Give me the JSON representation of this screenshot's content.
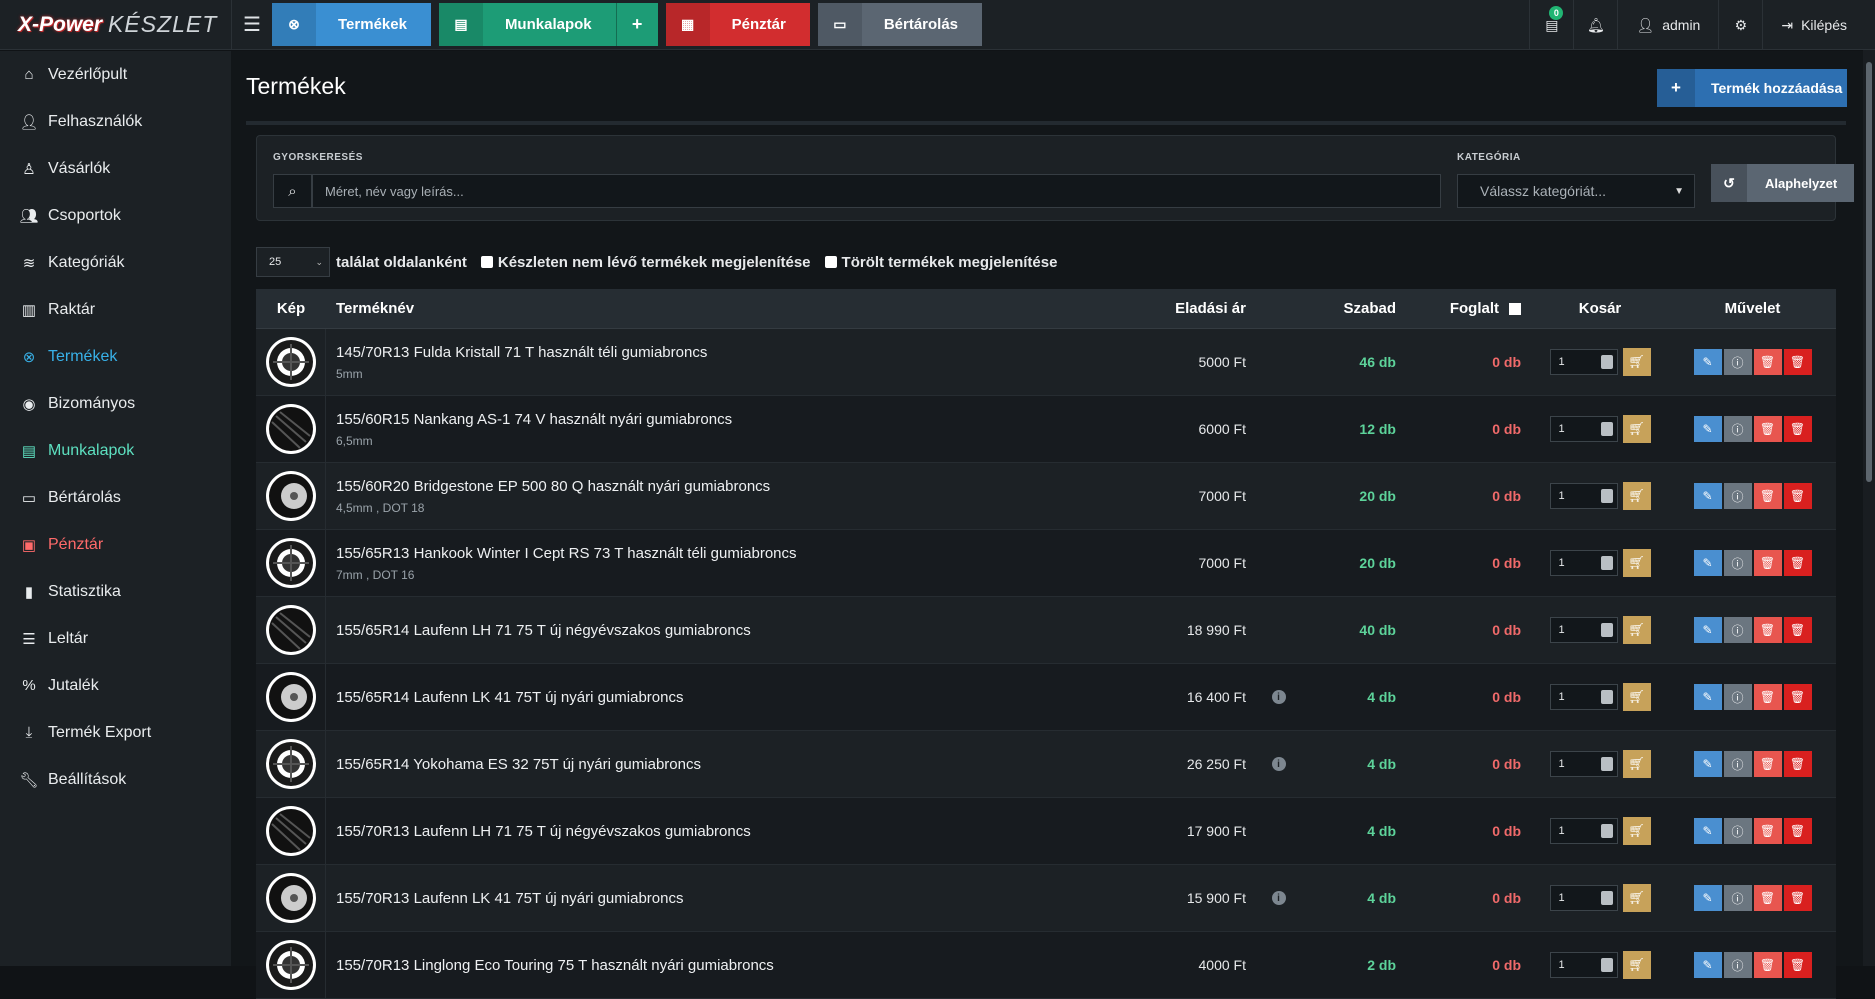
{
  "brand": {
    "part1": "X-Power",
    "part2": "KÉSZLET"
  },
  "topnav": [
    {
      "label": "Termékek",
      "icon": "tire-icon",
      "color": "#3a8fd2"
    },
    {
      "label": "Munkalapok",
      "icon": "document-icon",
      "color": "#1d9c76",
      "extra": "+"
    },
    {
      "label": "Pénztár",
      "icon": "calculator-icon",
      "color": "#d22d2f"
    },
    {
      "label": "Bértárolás",
      "icon": "archive-icon",
      "color": "#5b6672"
    }
  ],
  "topright": {
    "doc_badge": "0",
    "user": "admin",
    "logout": "Kilépés"
  },
  "sidebar": [
    {
      "label": "Vezérlőpult",
      "icon": "home-icon"
    },
    {
      "label": "Felhasználók",
      "icon": "user-icon"
    },
    {
      "label": "Vásárlók",
      "icon": "user-outline-icon"
    },
    {
      "label": "Csoportok",
      "icon": "users-icon"
    },
    {
      "label": "Kategóriák",
      "icon": "layers-icon"
    },
    {
      "label": "Raktár",
      "icon": "warehouse-icon"
    },
    {
      "label": "Termékek",
      "icon": "tire-icon"
    },
    {
      "label": "Bizományos",
      "icon": "user-circle-icon"
    },
    {
      "label": "Munkalapok",
      "icon": "document-icon"
    },
    {
      "label": "Bértárolás",
      "icon": "archive-icon"
    },
    {
      "label": "Pénztár",
      "icon": "money-icon"
    },
    {
      "label": "Statisztika",
      "icon": "chart-icon"
    },
    {
      "label": "Leltár",
      "icon": "list-icon"
    },
    {
      "label": "Jutalék",
      "icon": "percent-icon"
    },
    {
      "label": "Termék Export",
      "icon": "download-icon"
    },
    {
      "label": "Beállítások",
      "icon": "wrench-icon"
    }
  ],
  "page": {
    "title": "Termékek",
    "add_label": "Termék hozzáadása"
  },
  "filters": {
    "search_label": "GYORSKERESÉS",
    "search_placeholder": "Méret, név vagy leírás...",
    "category_label": "KATEGÓRIA",
    "category_placeholder": "Válassz kategóriát...",
    "reset_label": "Alaphelyzet"
  },
  "options": {
    "per_page": "25",
    "per_page_label": "találat oldalanként",
    "show_out_of_stock": "Készleten nem lévő termékek megjelenítése",
    "show_deleted": "Törölt termékek megjelenítése"
  },
  "table": {
    "headers": {
      "img": "Kép",
      "name": "Terméknév",
      "price": "Eladási ár",
      "free": "Szabad",
      "reserved": "Foglalt",
      "cart": "Kosár",
      "action": "Művelet"
    },
    "rows": [
      {
        "name": "145/70R13 Fulda Kristall 71 T használt téli gumiabroncs",
        "desc": "5mm",
        "price": "5000 Ft",
        "info": false,
        "free": "46 db",
        "reserved": "0 db",
        "qty": "1"
      },
      {
        "name": "155/60R15 Nankang AS-1 74 V használt nyári gumiabroncs",
        "desc": "6,5mm",
        "price": "6000 Ft",
        "info": false,
        "free": "12 db",
        "reserved": "0 db",
        "qty": "1"
      },
      {
        "name": "155/60R20 Bridgestone EP 500 80 Q használt nyári gumiabroncs",
        "desc": "4,5mm , DOT 18",
        "price": "7000 Ft",
        "info": false,
        "free": "20 db",
        "reserved": "0 db",
        "qty": "1"
      },
      {
        "name": "155/65R13 Hankook Winter I Cept RS 73 T használt téli gumiabroncs",
        "desc": "7mm , DOT 16",
        "price": "7000 Ft",
        "info": false,
        "free": "20 db",
        "reserved": "0 db",
        "qty": "1"
      },
      {
        "name": "155/65R14 Laufenn LH 71 75 T új négyévszakos gumiabroncs",
        "desc": "",
        "price": "18 990 Ft",
        "info": false,
        "free": "40 db",
        "reserved": "0 db",
        "qty": "1"
      },
      {
        "name": "155/65R14 Laufenn LK 41 75T új nyári gumiabroncs",
        "desc": "",
        "price": "16 400 Ft",
        "info": true,
        "free": "4 db",
        "reserved": "0 db",
        "qty": "1"
      },
      {
        "name": "155/65R14 Yokohama ES 32 75T új nyári gumiabroncs",
        "desc": "",
        "price": "26 250 Ft",
        "info": true,
        "free": "4 db",
        "reserved": "0 db",
        "qty": "1"
      },
      {
        "name": "155/70R13 Laufenn LH 71 75 T új négyévszakos gumiabroncs",
        "desc": "",
        "price": "17 900 Ft",
        "info": false,
        "free": "4 db",
        "reserved": "0 db",
        "qty": "1"
      },
      {
        "name": "155/70R13 Laufenn LK 41 75T új nyári gumiabroncs",
        "desc": "",
        "price": "15 900 Ft",
        "info": true,
        "free": "4 db",
        "reserved": "0 db",
        "qty": "1"
      },
      {
        "name": "155/70R13 Linglong Eco Touring 75 T használt nyári gumiabroncs",
        "desc": "",
        "price": "4000 Ft",
        "info": false,
        "free": "2 db",
        "reserved": "0 db",
        "qty": "1"
      }
    ]
  }
}
